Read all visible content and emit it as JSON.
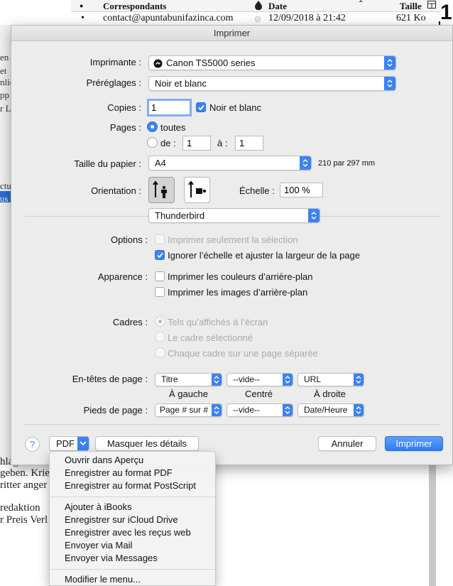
{
  "background": {
    "columns": {
      "dot": "●",
      "correspondants": "Correspondants",
      "date": "Date",
      "taille": "Taille"
    },
    "row": {
      "dot": "•",
      "email": "contact@apuntabunifazinca.com",
      "date": "12/09/2018 à 21:42",
      "size": "621 Ko"
    },
    "corner_number": "1",
    "left_fragments": [
      "en",
      "et",
      "nlic",
      "pp",
      "r Lin",
      "ctus",
      "us c"
    ],
    "body_lines": [
      "hlag",
      "geben. Krie",
      "ritter anger",
      "redaktion",
      "r Preis Verl"
    ]
  },
  "dialog": {
    "title": "Imprimer",
    "printer": {
      "label": "Imprimante :",
      "value": "Canon TS5000 series"
    },
    "presets": {
      "label": "Préréglages :",
      "value": "Noir et blanc"
    },
    "copies": {
      "label": "Copies :",
      "value": "1",
      "bw_label": "Noir et blanc"
    },
    "pages": {
      "label": "Pages :",
      "all": "toutes",
      "from_label": "de :",
      "from": "1",
      "to_label": "à :",
      "to": "1"
    },
    "paper": {
      "label": "Taille du papier :",
      "value": "A4",
      "dims": "210 par 297 mm"
    },
    "orientation": {
      "label": "Orientation :"
    },
    "scale": {
      "label": "Échelle :",
      "value": "100 %"
    },
    "section": {
      "value": "Thunderbird"
    },
    "options": {
      "label": "Options :",
      "selection_only": "Imprimer seulement la sélection",
      "ignore_scale": "Ignorer l’échelle et ajuster la largeur de la page"
    },
    "appearance": {
      "label": "Apparence :",
      "bg_colors": "Imprimer les couleurs d’arrière-plan",
      "bg_images": "Imprimer les images d’arrière-plan"
    },
    "frames": {
      "label": "Cadres :",
      "as_shown": "Tels qu’affichés à l’écran",
      "selected": "Le cadre sélectionné",
      "each": "Chaque cadre sur une page séparée"
    },
    "headers": {
      "label": "En-têtes de page :",
      "left": "Titre",
      "center": "--vide--",
      "right": "URL"
    },
    "positions": {
      "left": "À gauche",
      "center": "Centré",
      "right": "À droite"
    },
    "footers": {
      "label": "Pieds de page :",
      "left": "Page # sur #",
      "center": "--vide--",
      "right": "Date/Heure"
    },
    "buttons": {
      "help": "?",
      "pdf": "PDF",
      "hide_details": "Masquer les détails",
      "cancel": "Annuler",
      "print": "Imprimer"
    }
  },
  "pdf_menu": {
    "group1": [
      "Ouvrir dans Aperçu",
      "Enregistrer au format PDF",
      "Enregistrer au format PostScript"
    ],
    "group2": [
      "Ajouter à iBooks",
      "Enregistrer sur iCloud Drive",
      "Enregistrer avec les reçus web",
      "Envoyer via Mail",
      "Envoyer via Messages"
    ],
    "group3": [
      "Modifier le menu..."
    ]
  },
  "colors": {
    "accent": "#3b82f6",
    "sheet": "#ececec"
  }
}
